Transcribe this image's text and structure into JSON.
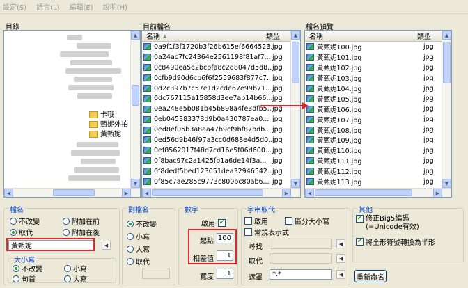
{
  "menu": [
    "設定(S)",
    "語言(L)",
    "編輯(E)",
    "說明(H)"
  ],
  "panels": {
    "directory_title": "目錄",
    "current_title": "目前檔名",
    "preview_title": "檔名預覽",
    "col_name": "名稱",
    "col_type": "類型"
  },
  "tree": {
    "items": [
      "卡哦",
      "甄妮外拍",
      "黃甄妮"
    ]
  },
  "current_files": [
    {
      "name": "0a9f1f3f1720b3f26b615ef6664523...",
      "type": "jpg"
    },
    {
      "name": "0a24ac7fc24364e2561198f81af7...",
      "type": "jpg"
    },
    {
      "name": "0c8490ea5e2bcbfa8c2d8047d5d8...",
      "type": "jpg"
    },
    {
      "name": "0cfb9d90d6cb6f6f2559683f877c7...",
      "type": "jpg"
    },
    {
      "name": "0d2c397b7c57e1d2cde67e99b71...",
      "type": "jpg"
    },
    {
      "name": "0dc767115a15858d3ee7ab14b66...",
      "type": "jpg"
    },
    {
      "name": "0ea248e5b081b45b898a4fe3dfb5...",
      "type": "jpg"
    },
    {
      "name": "0eb045383378d9b0a430787ea0...",
      "type": "jpg"
    },
    {
      "name": "0ed8ef05b3a8aa47b9cf9bf87bdb...",
      "type": "jpg"
    },
    {
      "name": "0ed56d9b46f97a3cc0d688e4d5d0...",
      "type": "jpg"
    },
    {
      "name": "0ef8562017f48d7cd16e5f06d600...",
      "type": "jpg"
    },
    {
      "name": "0f8bac97c2a1425fb1a6de14f3a...",
      "type": "jpg"
    },
    {
      "name": "0f8dedf5bed123051dea32946542...",
      "type": "jpg"
    },
    {
      "name": "0f85c7ae285c9773c800bc80ab6...",
      "type": "jpg"
    }
  ],
  "preview_files": [
    {
      "name": "黃甄妮100.jpg",
      "type": "jpg"
    },
    {
      "name": "黃甄妮101.jpg",
      "type": "jpg"
    },
    {
      "name": "黃甄妮102.jpg",
      "type": "jpg"
    },
    {
      "name": "黃甄妮103.jpg",
      "type": "jpg"
    },
    {
      "name": "黃甄妮104.jpg",
      "type": "jpg"
    },
    {
      "name": "黃甄妮105.jpg",
      "type": "jpg"
    },
    {
      "name": "黃甄妮106.jpg",
      "type": "jpg"
    },
    {
      "name": "黃甄妮107.jpg",
      "type": "jpg"
    },
    {
      "name": "黃甄妮108.jpg",
      "type": "jpg"
    },
    {
      "name": "黃甄妮109.jpg",
      "type": "jpg"
    },
    {
      "name": "黃甄妮110.jpg",
      "type": "jpg"
    },
    {
      "name": "黃甄妮111.jpg",
      "type": "jpg"
    },
    {
      "name": "黃甄妮112.jpg",
      "type": "jpg"
    },
    {
      "name": "黃甄妮113.jpg",
      "type": "jpg"
    }
  ],
  "filename_group": {
    "title": "檔名",
    "opt_keep": "不改變",
    "opt_prefix": "附加在前",
    "opt_replace": "取代",
    "opt_suffix": "附加在後",
    "value": "黃甄妮",
    "case_title": "大小寫",
    "case_keep": "不改變",
    "case_lower": "小寫",
    "case_first": "句首",
    "case_upper": "大寫"
  },
  "ext_group": {
    "title": "副檔名",
    "opt_keep": "不改變",
    "opt_lower": "小寫",
    "opt_upper": "大寫",
    "opt_replace": "取代"
  },
  "number_group": {
    "title": "數字",
    "enable_label": "啟用",
    "start_label": "起點",
    "start_value": "100",
    "step_label": "相差值",
    "step_value": "1",
    "width_label": "寬度",
    "width_value": "1"
  },
  "string_group": {
    "title": "字串取代",
    "enable_label": "啟用",
    "case_sensitive_label": "區分大小寫",
    "regex_label": "常規表示式",
    "find_label": "尋找",
    "replace_label": "取代",
    "mask_label": "遮罩",
    "mask_value": "*.*"
  },
  "other_group": {
    "title": "其他",
    "big5_label": "修正Big5編碼",
    "big5_sub": "(=Unicode有效)",
    "fullwidth_label": "將全形符號轉換為半形"
  },
  "rename_button": "重新命名",
  "colors": {
    "accent": "#0046d5",
    "highlight": "#e0262b",
    "check": "#21a121"
  }
}
